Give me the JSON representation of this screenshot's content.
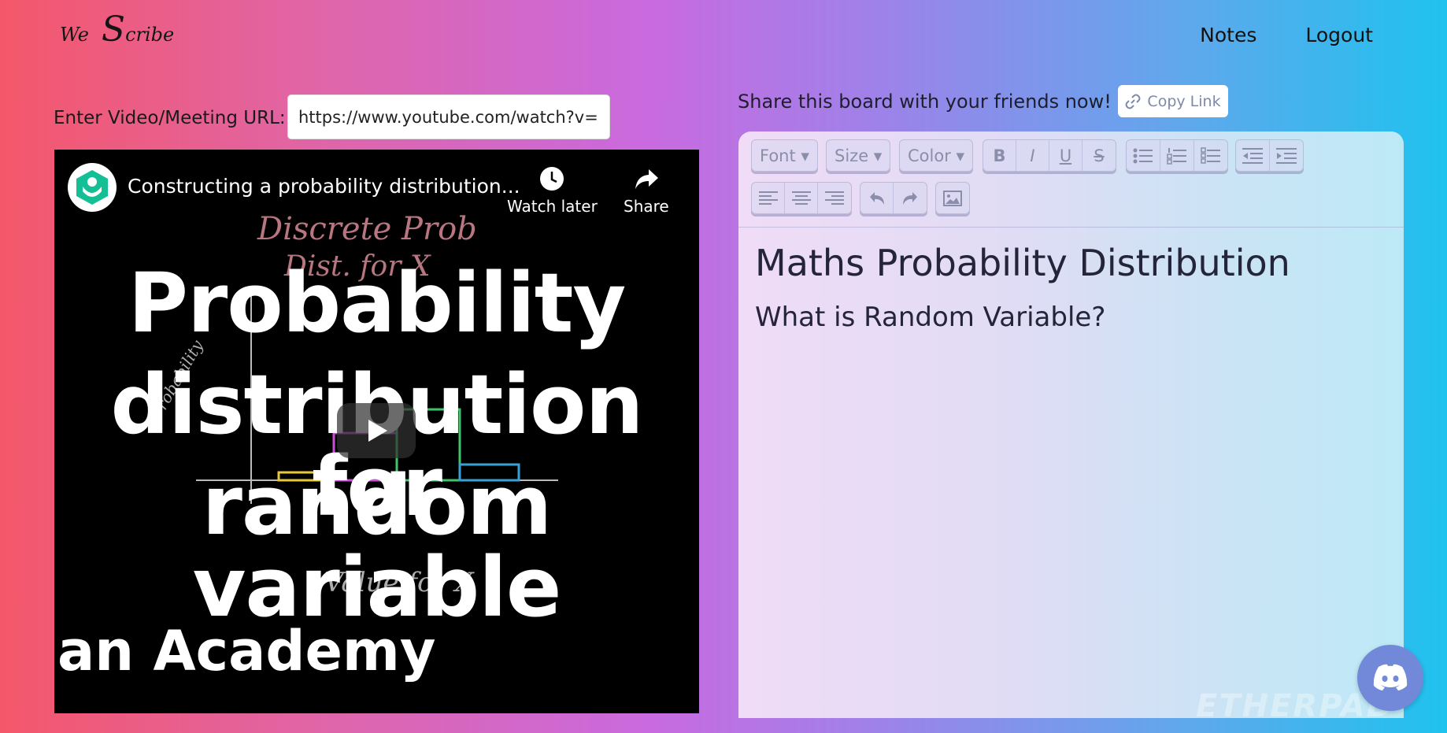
{
  "header": {
    "logo_first": "We",
    "logo_second": "S",
    "logo_rest": "cribe",
    "nav": [
      "Notes",
      "Logout"
    ]
  },
  "video_url": {
    "label": "Enter Video/Meeting URL:",
    "value": "https://www.youtube.com/watch?v="
  },
  "video": {
    "title": "Constructing a probability distribution...",
    "watch_later": "Watch later",
    "share": "Share",
    "headline_lines": [
      "Probability",
      "distribution for",
      "random variable"
    ],
    "brand": "an Academy",
    "handwriting": {
      "line1": "Discrete Prob",
      "line2": "Dist. for X",
      "axis_y": "Probability",
      "axis_x": "Value for X"
    }
  },
  "share": {
    "text": "Share this board with your friends now!",
    "copy_label": "Copy Link"
  },
  "toolbar": {
    "font": "Font",
    "size": "Size",
    "color": "Color",
    "bold": "B",
    "italic": "I",
    "underline": "U",
    "strike": "S"
  },
  "document": {
    "heading": "Maths Probability Distribution",
    "subheading": "What is Random Variable?"
  },
  "watermark": "ETHERPAD",
  "colors": {
    "discord": "#7289da",
    "khan_green": "#14bf96"
  }
}
